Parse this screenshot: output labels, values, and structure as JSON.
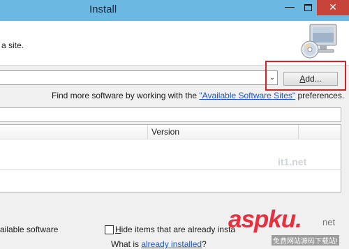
{
  "window": {
    "title": "Install",
    "minimize": "—",
    "close": "✕"
  },
  "header": {
    "description": "a site.",
    "icon": "monitor-cd-icon"
  },
  "work_with": {
    "value": "",
    "dropdown_arrow": "⌄",
    "add_label_u": "A",
    "add_label_rest": "dd..."
  },
  "find_more": {
    "prefix": "Find more software by working with the ",
    "link": "\"Available Software Sites\"",
    "suffix": " preferences."
  },
  "filter": {
    "value": ""
  },
  "table": {
    "columns": [
      "",
      "Version"
    ]
  },
  "options": {
    "show_latest": "ailable software",
    "hide_installed_u": "H",
    "hide_installed_rest": "ide items that are already insta",
    "what_is_prefix": "What is ",
    "what_is_link": "already installed",
    "what_is_suffix": "?"
  },
  "watermark": {
    "brand": "aspku",
    "domain_dot": ".",
    "domain": "net",
    "sub": "免费网站源码下载站!",
    "faint": "it1.net"
  },
  "colors": {
    "titlebar": "#6bb8e3",
    "close": "#c7443a",
    "highlight": "#d0242b",
    "link": "#1a56c4"
  }
}
